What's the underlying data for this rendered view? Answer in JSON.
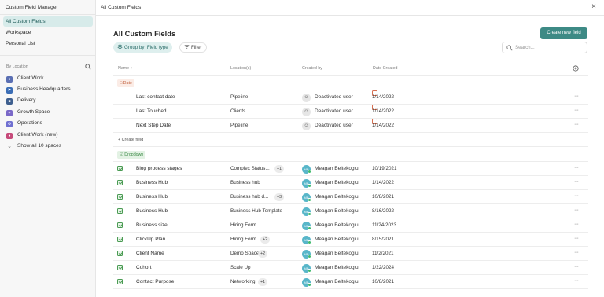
{
  "sidebar": {
    "title": "Custom Field Manager",
    "items": [
      {
        "label": "All Custom Fields",
        "active": true
      },
      {
        "label": "Workspace",
        "active": false
      },
      {
        "label": "Personal List",
        "active": false
      }
    ],
    "section_label": "By Location",
    "locations": [
      {
        "label": "Client Work",
        "icon": "person-icon",
        "color": "#5a6fb3",
        "glyph": "●"
      },
      {
        "label": "Business Headquarters",
        "icon": "flag-icon",
        "color": "#3a6db5",
        "glyph": "⚑"
      },
      {
        "label": "Delivery",
        "icon": "truck-icon",
        "color": "#3e5f8f",
        "glyph": "■"
      },
      {
        "label": "Growth Space",
        "icon": "sparkle-icon",
        "color": "#7a68c8",
        "glyph": "+"
      },
      {
        "label": "Operations",
        "icon": "gear-icon",
        "color": "#6f6fd1",
        "glyph": "⚙"
      },
      {
        "label": "Client Work (new)",
        "icon": "person-icon",
        "color": "#c64a7a",
        "glyph": "●"
      },
      {
        "label": "Show all 10 spaces",
        "icon": "chevron-down-icon",
        "color": "#777777",
        "glyph": "⌄"
      }
    ]
  },
  "topbar": {
    "title": "All Custom Fields",
    "close": "×"
  },
  "main": {
    "title": "All Custom Fields",
    "create_button": "Create new field",
    "group_by": "Group by: Field type",
    "filter": "Filter",
    "search_placeholder": "Search...",
    "columns": {
      "name": "Name ↑",
      "location": "Location(s)",
      "created_by": "Created by",
      "date_created": "Date Created"
    },
    "groups": [
      {
        "label": "Date",
        "type": "date",
        "rows": [
          {
            "name": "Last contact date",
            "location": "Pipeline",
            "more": "",
            "user": "Deactivated user",
            "user_type": "deactivated",
            "date": "1/14/2022"
          },
          {
            "name": "Last Touched",
            "location": "Clients",
            "more": "",
            "user": "Deactivated user",
            "user_type": "deactivated",
            "date": "1/14/2022"
          },
          {
            "name": "Next Step Date",
            "location": "Pipeline",
            "more": "",
            "user": "Deactivated user",
            "user_type": "deactivated",
            "date": "1/14/2022"
          }
        ],
        "create_label": "+ Create field"
      },
      {
        "label": "Dropdown",
        "type": "dropdown",
        "rows": [
          {
            "name": "Blog process stages",
            "location": "Complex Status...",
            "more": "+1",
            "user": "Meagan Beltekoglu",
            "user_type": "avatar",
            "date": "10/19/2021"
          },
          {
            "name": "Business Hub",
            "location": "Business hub",
            "more": "",
            "user": "Meagan Beltekoglu",
            "user_type": "avatar",
            "date": "1/14/2022"
          },
          {
            "name": "Business Hub",
            "location": "Business hub d...",
            "more": "+3",
            "user": "Meagan Beltekoglu",
            "user_type": "avatar",
            "date": "10/8/2021"
          },
          {
            "name": "Business Hub",
            "location": "Business Hub Template",
            "more": "",
            "user": "Meagan Beltekoglu",
            "user_type": "avatar",
            "date": "8/16/2022"
          },
          {
            "name": "Business size",
            "location": "Hiring Form",
            "more": "",
            "user": "Meagan Beltekoglu",
            "user_type": "avatar",
            "date": "11/24/2023"
          },
          {
            "name": "ClickUp Plan",
            "location": "Hiring Form",
            "more": "+2",
            "user": "Meagan Beltekoglu",
            "user_type": "avatar",
            "date": "8/15/2021"
          },
          {
            "name": "Client Name",
            "location": "Demo Space",
            "more": "+2",
            "user": "Meagan Beltekoglu",
            "user_type": "avatar",
            "date": "11/2/2021"
          },
          {
            "name": "Cohort",
            "location": "Scale Up",
            "more": "",
            "user": "Meagan Beltekoglu",
            "user_type": "avatar",
            "date": "1/22/2024"
          },
          {
            "name": "Contact Purpose",
            "location": "Networking",
            "more": "+1",
            "user": "Meagan Beltekoglu",
            "user_type": "avatar",
            "date": "10/8/2021"
          }
        ]
      }
    ],
    "avatar_initials": "MB",
    "deactivated_glyph": "☺",
    "row_menu": "···"
  }
}
